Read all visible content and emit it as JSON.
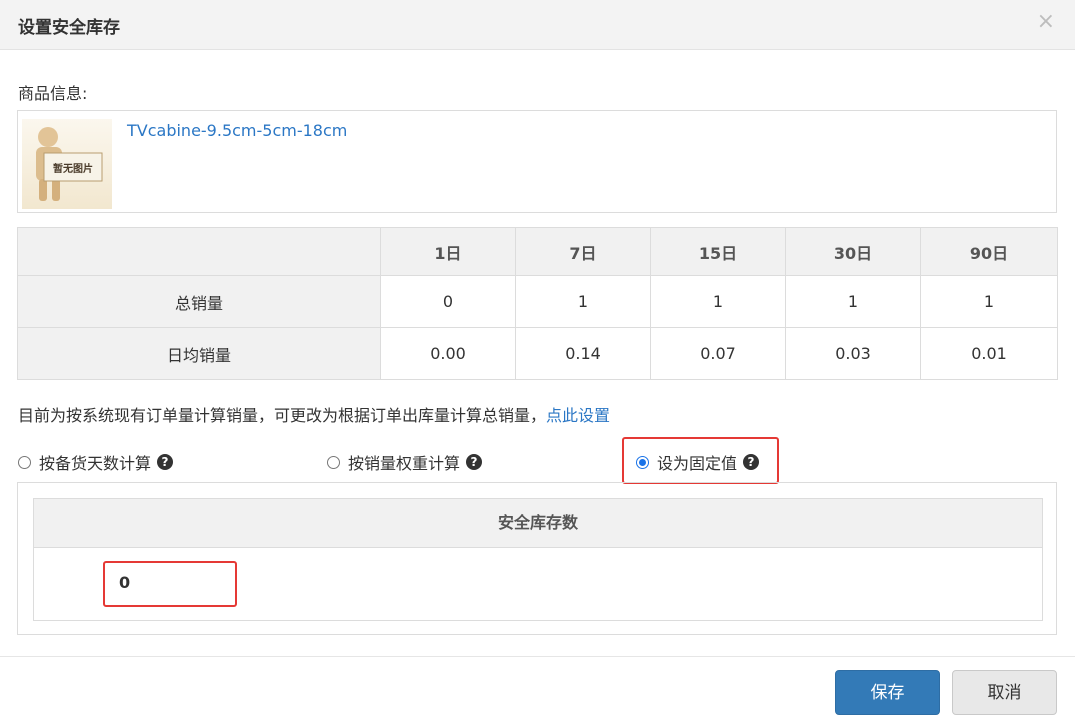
{
  "dialog": {
    "title": "设置安全库存",
    "close_glyph": "×"
  },
  "product": {
    "section_label": "商品信息:",
    "image_placeholder_text": "暂无图片",
    "name": "TVcabine-9.5cm-5cm-18cm"
  },
  "sales_table": {
    "headers": [
      "",
      "1日",
      "7日",
      "15日",
      "30日",
      "90日"
    ],
    "rows": [
      {
        "label": "总销量",
        "values": [
          "0",
          "1",
          "1",
          "1",
          "1"
        ]
      },
      {
        "label": "日均销量",
        "values": [
          "0.00",
          "0.14",
          "0.07",
          "0.03",
          "0.01"
        ]
      }
    ]
  },
  "calc_note": {
    "text": "目前为按系统现有订单量计算销量，可更改为根据订单出库量计算总销量，",
    "link": "点此设置"
  },
  "options": [
    {
      "label": "按备货天数计算",
      "checked": false
    },
    {
      "label": "按销量权重计算",
      "checked": false
    },
    {
      "label": "设为固定值",
      "checked": true
    }
  ],
  "stock": {
    "header": "安全库存数",
    "value": "0"
  },
  "buttons": {
    "save": "保存",
    "cancel": "取消"
  },
  "colors": {
    "link": "#2b77c5",
    "primary": "#337ab7",
    "highlight": "#e53935",
    "radio_checked": "#1a73e8"
  }
}
